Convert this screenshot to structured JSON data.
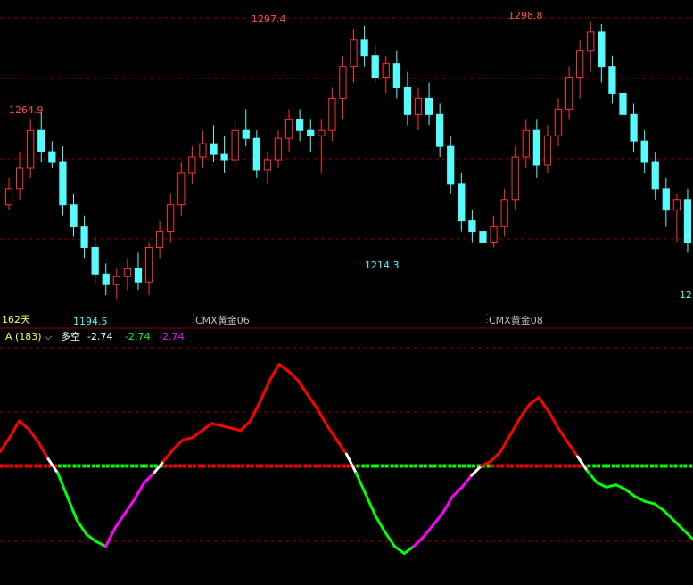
{
  "chart_data": [
    {
      "type": "candlestick",
      "title": "",
      "price_labels": {
        "left_high": "1264.9",
        "left_low": "1194.5",
        "mid_high": "1297.4",
        "mid_low": "1214.3",
        "right_high": "1298.8",
        "right_edge": "12"
      },
      "bar_count_label": "162天",
      "contract_labels": [
        "CMX黄金06",
        "CMX黄金08"
      ],
      "ylim": [
        1188,
        1302
      ],
      "candles": [
        [
          1230,
          1240,
          1228,
          1236
        ],
        [
          1236,
          1250,
          1232,
          1244
        ],
        [
          1244,
          1262,
          1240,
          1258
        ],
        [
          1258,
          1264.9,
          1246,
          1250
        ],
        [
          1250,
          1254,
          1244,
          1246
        ],
        [
          1246,
          1252,
          1226,
          1230
        ],
        [
          1230,
          1234,
          1218,
          1222
        ],
        [
          1222,
          1226,
          1210,
          1214
        ],
        [
          1214,
          1218,
          1200,
          1204
        ],
        [
          1204,
          1208,
          1196,
          1200
        ],
        [
          1200,
          1206,
          1194.5,
          1203
        ],
        [
          1203,
          1210,
          1198,
          1206
        ],
        [
          1206,
          1212,
          1198,
          1201
        ],
        [
          1201,
          1216,
          1196,
          1214
        ],
        [
          1214,
          1224,
          1210,
          1220
        ],
        [
          1220,
          1234,
          1216,
          1230
        ],
        [
          1230,
          1246,
          1226,
          1242
        ],
        [
          1242,
          1252,
          1238,
          1248
        ],
        [
          1248,
          1258,
          1244,
          1253
        ],
        [
          1253,
          1260,
          1246,
          1249
        ],
        [
          1249,
          1256,
          1242,
          1247
        ],
        [
          1247,
          1262,
          1244,
          1258
        ],
        [
          1258,
          1266,
          1252,
          1255
        ],
        [
          1255,
          1258,
          1240,
          1243
        ],
        [
          1243,
          1250,
          1238,
          1247
        ],
        [
          1247,
          1258,
          1244,
          1255
        ],
        [
          1255,
          1266,
          1250,
          1262
        ],
        [
          1262,
          1266,
          1254,
          1258
        ],
        [
          1258,
          1262,
          1250,
          1256
        ],
        [
          1256,
          1262,
          1242,
          1258
        ],
        [
          1258,
          1274,
          1254,
          1270
        ],
        [
          1270,
          1286,
          1262,
          1282
        ],
        [
          1282,
          1296,
          1276,
          1292
        ],
        [
          1292,
          1297.4,
          1282,
          1286
        ],
        [
          1286,
          1290,
          1276,
          1278
        ],
        [
          1278,
          1286,
          1272,
          1283
        ],
        [
          1283,
          1288,
          1270,
          1274
        ],
        [
          1274,
          1280,
          1260,
          1264
        ],
        [
          1264,
          1274,
          1258,
          1270
        ],
        [
          1270,
          1276,
          1260,
          1264
        ],
        [
          1264,
          1268,
          1248,
          1252
        ],
        [
          1252,
          1256,
          1234,
          1238
        ],
        [
          1238,
          1242,
          1220,
          1224
        ],
        [
          1224,
          1228,
          1216,
          1220
        ],
        [
          1220,
          1224,
          1214.3,
          1216
        ],
        [
          1216,
          1226,
          1214,
          1222
        ],
        [
          1222,
          1236,
          1218,
          1232
        ],
        [
          1232,
          1252,
          1228,
          1248
        ],
        [
          1248,
          1262,
          1244,
          1258
        ],
        [
          1258,
          1262,
          1240,
          1245
        ],
        [
          1245,
          1260,
          1242,
          1256
        ],
        [
          1256,
          1270,
          1252,
          1266
        ],
        [
          1266,
          1282,
          1262,
          1278
        ],
        [
          1278,
          1292,
          1270,
          1288
        ],
        [
          1288,
          1298.8,
          1280,
          1295
        ],
        [
          1295,
          1298,
          1276,
          1282
        ],
        [
          1282,
          1286,
          1268,
          1272
        ],
        [
          1272,
          1276,
          1260,
          1264
        ],
        [
          1264,
          1268,
          1250,
          1254
        ],
        [
          1254,
          1258,
          1242,
          1246
        ],
        [
          1246,
          1250,
          1232,
          1236
        ],
        [
          1236,
          1240,
          1222,
          1228
        ],
        [
          1228,
          1234,
          1216,
          1232
        ],
        [
          1232,
          1236,
          1212,
          1216
        ]
      ]
    },
    {
      "type": "line",
      "indicator_label": "A (183)",
      "caret": "⌵",
      "series_name": "多空",
      "readouts": [
        "-2.74",
        "-2.74",
        "-2.74"
      ],
      "ylim": [
        -100,
        100
      ],
      "zero_line": 0,
      "values": [
        12,
        24,
        38,
        31,
        20,
        6,
        -6,
        -26,
        -46,
        -58,
        -64,
        -68,
        -52,
        -40,
        -28,
        -14,
        -6,
        4,
        14,
        22,
        24,
        30,
        36,
        34,
        32,
        30,
        38,
        54,
        72,
        86,
        80,
        72,
        60,
        48,
        34,
        22,
        10,
        -6,
        -24,
        -42,
        -56,
        -68,
        -74,
        -68,
        -60,
        -50,
        -40,
        -26,
        -18,
        -8,
        0,
        4,
        12,
        26,
        40,
        52,
        58,
        46,
        32,
        20,
        8,
        -4,
        -14,
        -18,
        -16,
        -20,
        -26,
        -30,
        -32,
        -38,
        -46,
        -54,
        -62
      ]
    }
  ],
  "colors": {
    "up": "#ff3232",
    "down": "#54fcfc",
    "grid": "#8a0000",
    "line_pos": "#ff0000",
    "line_neg": "#00ff00",
    "line_transition": "#ff00ff",
    "zero_pos": "#ff0000",
    "zero_neg": "#00ff00",
    "text_high": "#ff5050",
    "text_low": "#54fcfc",
    "text_days": "#ffff50",
    "text_contract": "#c0c0c0",
    "text_white": "#ffffff",
    "text_green": "#00ff00",
    "text_magenta": "#ff00ff"
  }
}
